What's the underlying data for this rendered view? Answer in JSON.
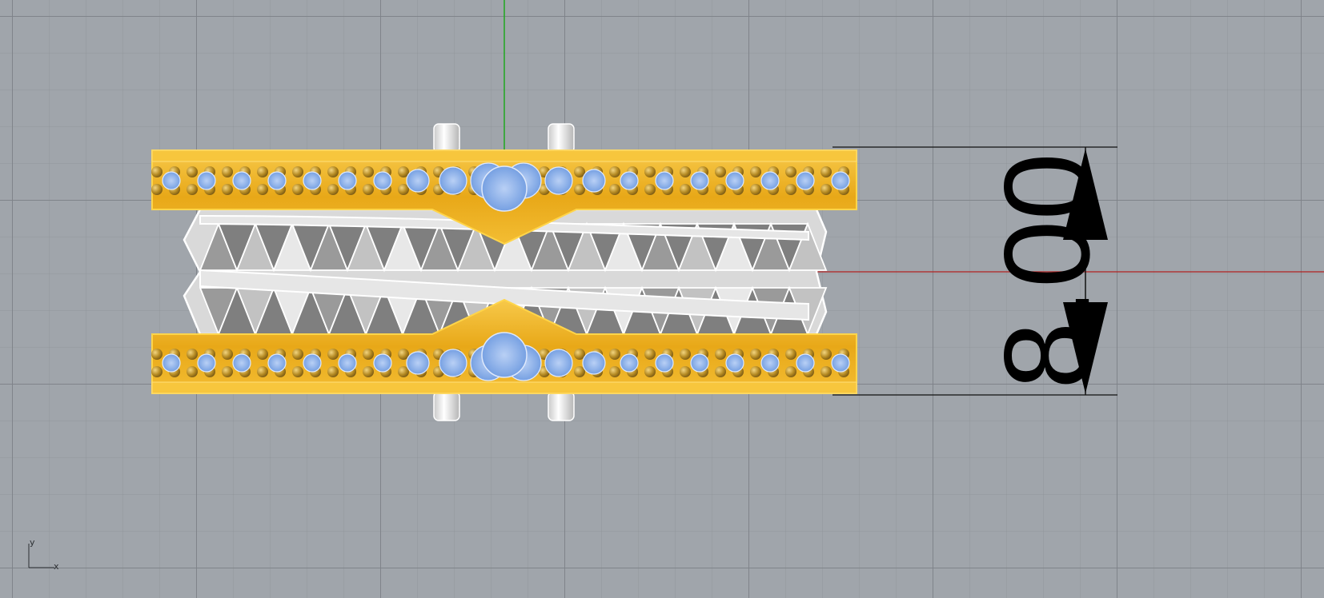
{
  "viewport": {
    "dimension": {
      "value_text": "8.00",
      "value": 8.0
    },
    "axis_indicator": {
      "y_label": "y",
      "x_label": "x"
    }
  },
  "colors": {
    "background": "#a0a5ab",
    "x_axis": "#b02020",
    "y_axis": "#1fa81f",
    "gold": "#f1b221",
    "stone": "#8ab0e8",
    "band": "#d4d4d4"
  }
}
